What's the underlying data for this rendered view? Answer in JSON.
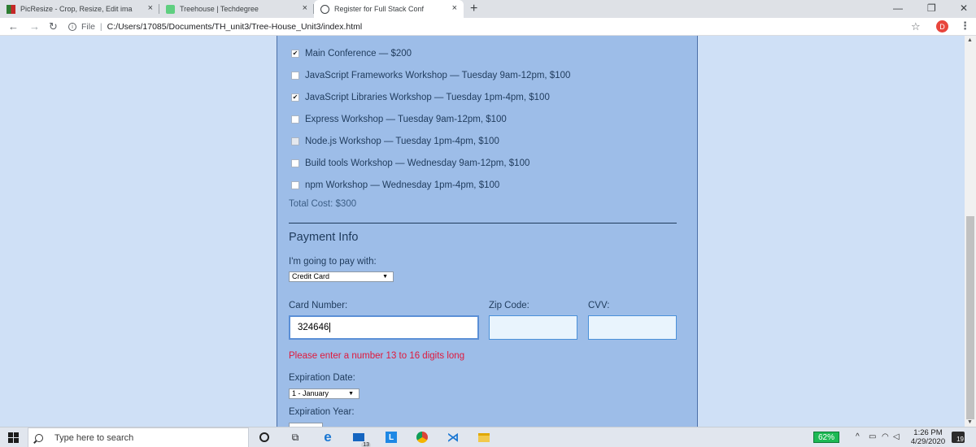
{
  "browser": {
    "tabs": [
      {
        "title": "PicResize - Crop, Resize, Edit ima",
        "close": "×",
        "icon": "picresize-favicon"
      },
      {
        "title": "Treehouse | Techdegree",
        "close": "×",
        "icon": "treehouse-favicon"
      },
      {
        "title": "Register for Full Stack Conf",
        "close": "×",
        "icon": "globe-favicon"
      }
    ],
    "new_tab": "+",
    "window_controls": {
      "minimize": "—",
      "maximize": "❐",
      "close": "✕"
    },
    "nav": {
      "back": "←",
      "forward": "→",
      "reload": "↻"
    },
    "address": {
      "protocol": "File",
      "separator": "|",
      "url": "C:/Users/17085/Documents/TH_unit3/Tree-House_Unit3/index.html"
    },
    "bookmark_star": "☆",
    "profile_initial": "D",
    "menu": "⋮"
  },
  "page": {
    "activities": [
      {
        "label": "Main Conference — $200",
        "checked": true,
        "disabled": false
      },
      {
        "label": "JavaScript Frameworks Workshop — Tuesday 9am-12pm, $100",
        "checked": false,
        "disabled": false
      },
      {
        "label": "JavaScript Libraries Workshop — Tuesday 1pm-4pm, $100",
        "checked": true,
        "disabled": false
      },
      {
        "label": "Express Workshop — Tuesday 9am-12pm, $100",
        "checked": false,
        "disabled": false
      },
      {
        "label": "Node.js Workshop — Tuesday 1pm-4pm, $100",
        "checked": false,
        "disabled": true
      },
      {
        "label": "Build tools Workshop — Wednesday 9am-12pm, $100",
        "checked": false,
        "disabled": false
      },
      {
        "label": "npm Workshop — Wednesday 1pm-4pm, $100",
        "checked": false,
        "disabled": false
      }
    ],
    "check_glyph": "✔",
    "total": "Total Cost: $300",
    "payment": {
      "title": "Payment Info",
      "pay_label": "I'm going to pay with:",
      "pay_method": "Credit Card",
      "card_label": "Card Number:",
      "card_value": "324646",
      "zip_label": "Zip Code:",
      "zip_value": "",
      "cvv_label": "CVV:",
      "cvv_value": "",
      "error": "Please enter a number 13 to 16 digits long",
      "exp_date_label": "Expiration Date:",
      "exp_month": "1 - January",
      "exp_year_label": "Expiration Year:"
    },
    "select_arrow": "▼"
  },
  "taskbar": {
    "search_placeholder": "Type here to search",
    "mail_badge": "13",
    "battery": "62%",
    "time": "1:26 PM",
    "date": "4/29/2020",
    "notifications": "19"
  },
  "colors": {
    "panel": "#9dbde8",
    "page_bg": "#cfe0f6",
    "error": "#e0193c",
    "field_border": "#4a90d9"
  }
}
